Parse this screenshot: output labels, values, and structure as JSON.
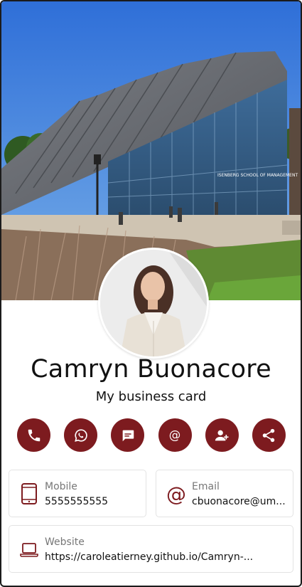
{
  "profile": {
    "name": "Camryn Buonacore",
    "subtitle": "My business card"
  },
  "cover": {
    "building_sign": "ISENBERG SCHOOL OF MANAGEMENT"
  },
  "actions": [
    {
      "icon": "phone-icon"
    },
    {
      "icon": "whatsapp-icon"
    },
    {
      "icon": "message-icon"
    },
    {
      "icon": "at-icon"
    },
    {
      "icon": "add-contact-icon"
    },
    {
      "icon": "share-icon"
    }
  ],
  "contacts": {
    "mobile": {
      "label": "Mobile",
      "value": "5555555555",
      "icon": "mobile-phone-icon"
    },
    "email": {
      "label": "Email",
      "value": "cbuonacore@um...",
      "icon": "at-icon"
    },
    "website": {
      "label": "Website",
      "value": "https://caroleatierney.github.io/Camryn-...",
      "icon": "laptop-icon"
    }
  },
  "colors": {
    "accent": "#7d1b1f",
    "card_border": "#e3e3e3",
    "label_gray": "#777777"
  }
}
